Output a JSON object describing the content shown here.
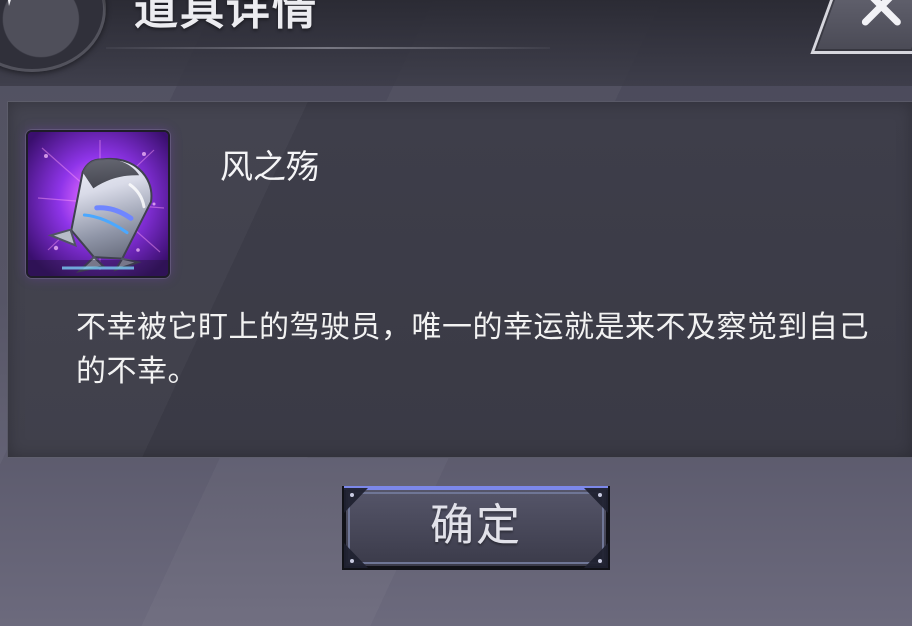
{
  "screen": {
    "title": "道具详情"
  },
  "item": {
    "name": "风之殇",
    "description": "不幸被它盯上的驾驶员，唯一的幸运就是来不及察觉到自己的不幸。"
  },
  "actions": {
    "confirm_label": "确定"
  },
  "icons": {
    "emblem": "guild-emblem-icon",
    "close": "close-icon",
    "item": "rocket-item-icon"
  },
  "colors": {
    "item_background": "#8d2ef2",
    "panel_background": "#3d3d48",
    "button_accent": "#7c88ea"
  }
}
